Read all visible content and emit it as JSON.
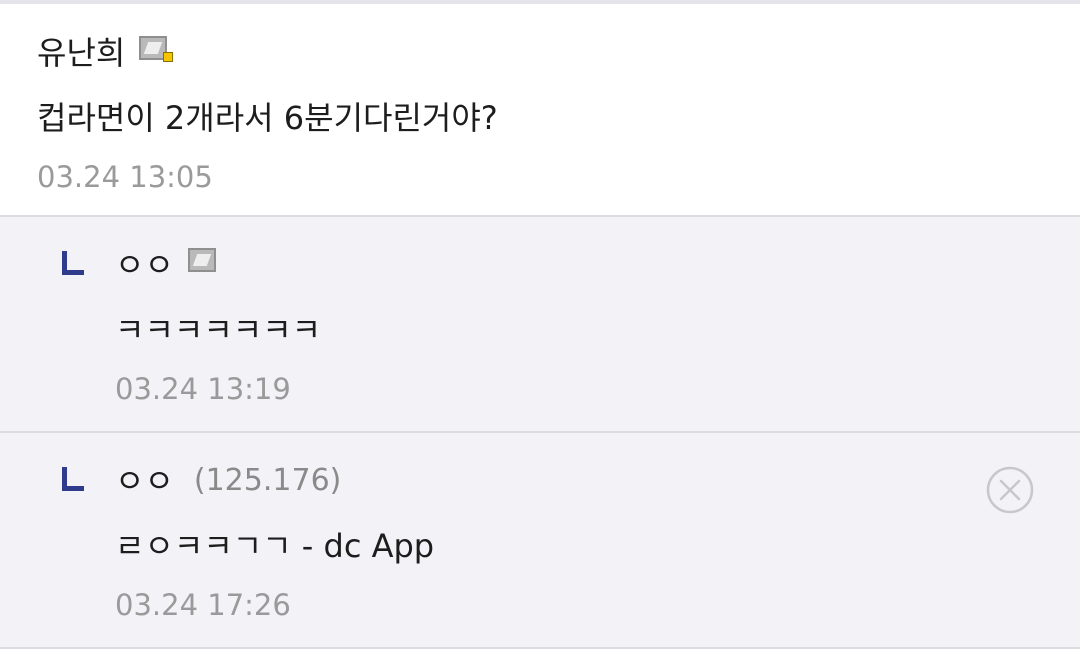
{
  "comments": [
    {
      "author": "유난희",
      "text": "컵라면이 2개라서 6분기다린거야?",
      "date": "03.24 13:05",
      "badge_icon": "fixed-nick-badge-icon"
    }
  ],
  "replies": [
    {
      "author": "ㅇㅇ",
      "text": "ㅋㅋㅋㅋㅋㅋㅋ",
      "date": "03.24 13:19",
      "badge_icon": "fixed-nick-badge-icon"
    },
    {
      "author": "ㅇㅇ",
      "ip": "(125.176)",
      "text": "ㄹㅇㅋㅋㄱㄱ - dc App",
      "date": "03.24 17:26",
      "delete_icon": "close-circle-icon"
    }
  ],
  "colors": {
    "reply_background": "#f3f3f7",
    "reply_marker": "#2f3c8c",
    "badge_dot": "#f5c400",
    "meta_text": "#9a9a9a"
  }
}
